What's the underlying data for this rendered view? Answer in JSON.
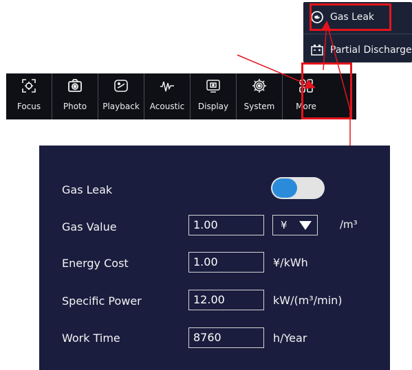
{
  "menu": {
    "items": [
      {
        "label": "Gas Leak",
        "icon": "gas-leak-icon"
      },
      {
        "label": "Partial Discharge",
        "icon": "partial-discharge-icon"
      }
    ]
  },
  "toolbar": {
    "items": [
      {
        "label": "Focus",
        "icon": "focus-icon"
      },
      {
        "label": "Photo",
        "icon": "camera-icon"
      },
      {
        "label": "Playback",
        "icon": "playback-icon"
      },
      {
        "label": "Acoustic",
        "icon": "waveform-icon"
      },
      {
        "label": "Display",
        "icon": "display-icon"
      },
      {
        "label": "System",
        "icon": "gear-icon"
      },
      {
        "label": "More",
        "icon": "grid-icon"
      }
    ]
  },
  "settings": {
    "gas_leak": {
      "label": "Gas Leak",
      "enabled": true
    },
    "gas_value": {
      "label": "Gas Value",
      "value": "1.00",
      "currency": "¥",
      "suffix": "/m³"
    },
    "energy_cost": {
      "label": "Energy Cost",
      "value": "1.00",
      "unit": "¥/kWh"
    },
    "specific_power": {
      "label": "Specific Power",
      "value": "12.00",
      "unit": "kW/(m³/min)"
    },
    "work_time": {
      "label": "Work Time",
      "value": "8760",
      "unit": "h/Year"
    }
  },
  "colors": {
    "panel_bg": "#1a1d3e",
    "toolbar_bg": "#0e1016",
    "menu_bg": "#1b2236",
    "accent": "#2a8bdb",
    "annotation": "#e5141c"
  }
}
